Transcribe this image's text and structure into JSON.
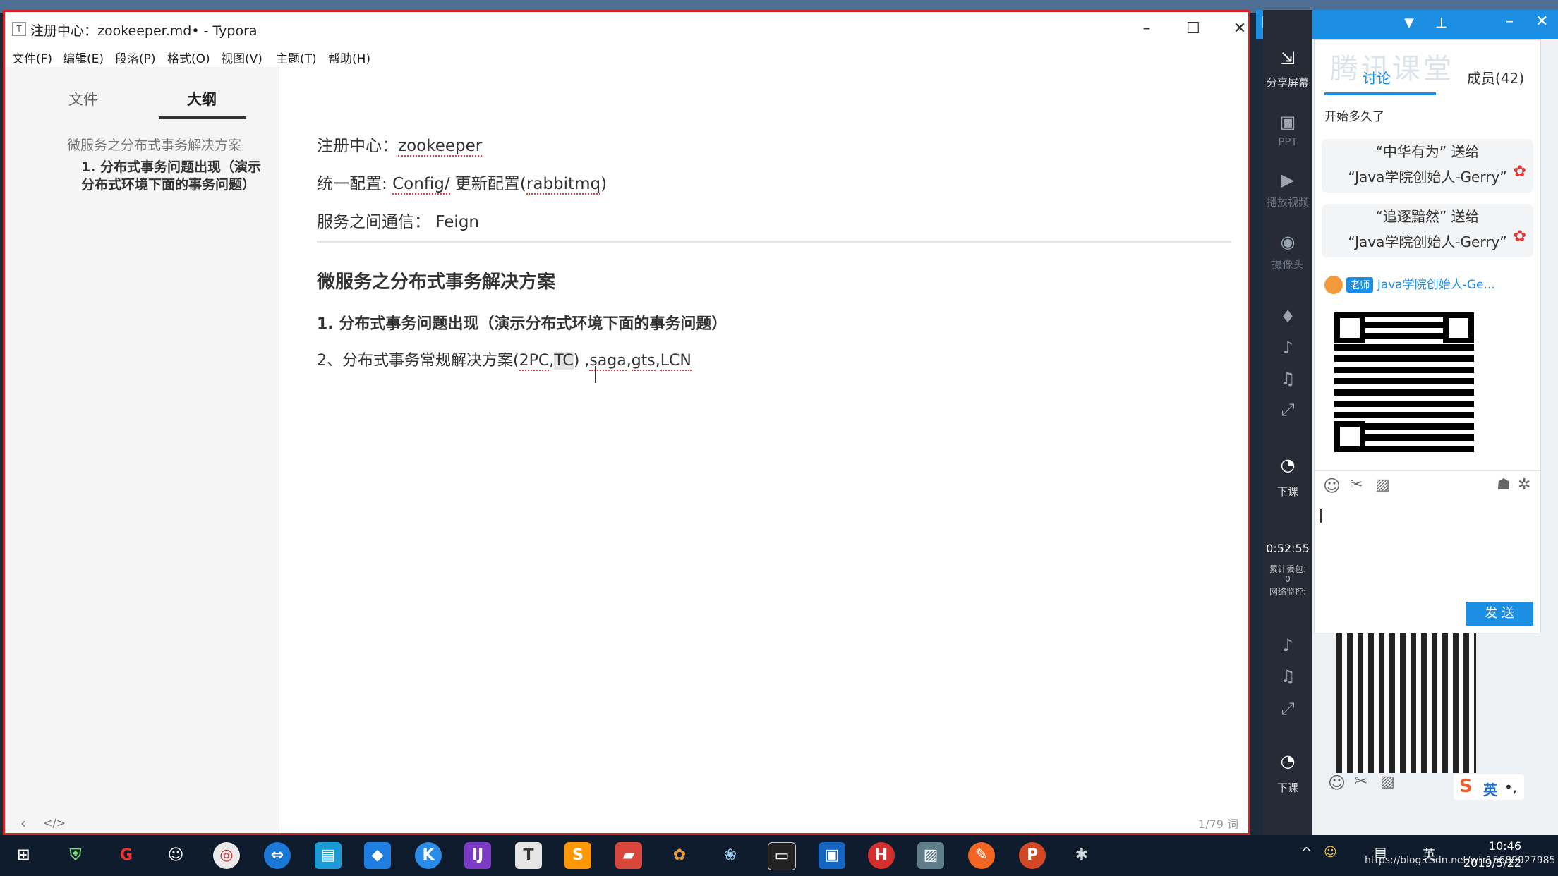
{
  "window": {
    "title": "注册中心：zookeeper.md• - Typora",
    "menu": [
      "文件(F)",
      "编辑(E)",
      "段落(P)",
      "格式(O)",
      "视图(V)",
      "主题(T)",
      "帮助(H)"
    ]
  },
  "sidebar": {
    "tabs": [
      "文件",
      "大纲"
    ],
    "outline": {
      "h2": "微服务之分布式事务解决方案",
      "h3": "1. 分布式事务问题出现（演示分布式环境下面的事务问题）"
    }
  },
  "editor": {
    "line1_label": "注册中心：",
    "line1_value": "zookeeper",
    "line2_label": "统一配置: ",
    "line2_config": "Config/",
    "line2_mid": " 更新配置(",
    "line2_rabbit": "rabbitmq",
    "line2_end": ")",
    "line3": "服务之间通信： Feign",
    "heading": "微服务之分布式事务解决方案",
    "subheading": "1. 分布式事务问题出现（演示分布式环境下面的事务问题）",
    "line4_a": "2、分布式事务常规解决方案(",
    "line4_2pc": "2PC",
    "line4_comma": ",",
    "line4_tc": "TC",
    "line4_b": ") ,",
    "line4_saga": "saga",
    "line4_c": ",",
    "line4_gts": "gts",
    "line4_d": ",",
    "line4_lcn": "LCN",
    "word_count": "1/79 词"
  },
  "classroom": {
    "watermark": "腾讯课堂",
    "tabs": [
      "讨论",
      "成员(42)"
    ],
    "message1": "开始多久了",
    "gift1_line1": "“中华有为” 送给",
    "gift1_line2": "“Java学院创始人-Gerry”",
    "gift2_line1": "“追逐黯然” 送给",
    "gift2_line2": "“Java学院创始人-Gerry”",
    "teacher_badge": "老师",
    "teacher_name": "Java学院创始人-Ge...",
    "send_label": "发 送",
    "sidebar_labels": {
      "share_screen": "分享屏幕",
      "ppt": "PPT",
      "video": "播放视频",
      "camera": "摄像头",
      "end_class": "下课",
      "end_class2": "下课",
      "timer": "0:52:55",
      "packet_loss": "累计丢包:",
      "packet_value": "0",
      "network": "网络监控:"
    },
    "ime_label": "英"
  },
  "taskbar": {
    "time": "10:46",
    "date": "2019/5/22",
    "tray_lang": "英",
    "watermark_url": "https://blog.csdn.net/wtr15689927985"
  },
  "colors": {
    "accent": "#1c8fe3",
    "window_border": "#e02020",
    "taskbar": "#0e1c2e"
  }
}
